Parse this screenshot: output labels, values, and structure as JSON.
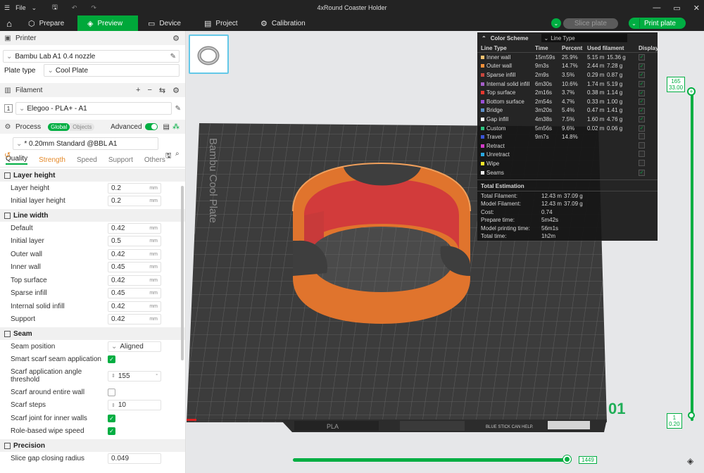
{
  "titlebar": {
    "file_label": "File",
    "title": "4xRound Coaster Holder"
  },
  "nav": {
    "tabs": [
      {
        "label": "Prepare",
        "icon": "cube-icon"
      },
      {
        "label": "Preview",
        "icon": "layers-icon"
      },
      {
        "label": "Device",
        "icon": "monitor-icon"
      },
      {
        "label": "Project",
        "icon": "project-icon"
      },
      {
        "label": "Calibration",
        "icon": "calibration-icon"
      }
    ],
    "slice_label": "Slice plate",
    "print_label": "Print plate",
    "colors": {
      "accent": "#00ae42",
      "bar": "#232323"
    }
  },
  "printer": {
    "section": "Printer",
    "name": "Bambu Lab A1 0.4 nozzle",
    "plate_type_label": "Plate type",
    "plate_type_value": "Cool Plate"
  },
  "filament": {
    "section": "Filament",
    "index": "1",
    "name": "Elegoo - PLA+ - A1"
  },
  "process": {
    "section": "Process",
    "global_label": "Global",
    "objects_label": "Objects",
    "advanced_label": "Advanced",
    "preset": "* 0.20mm Standard @BBL A1",
    "tabs": [
      "Quality",
      "Strength",
      "Speed",
      "Support",
      "Others"
    ]
  },
  "settings": {
    "layer_height": {
      "title": "Layer height",
      "rows": [
        {
          "label": "Layer height",
          "value": "0.2",
          "unit": "mm"
        },
        {
          "label": "Initial layer height",
          "value": "0.2",
          "unit": "mm"
        }
      ]
    },
    "line_width": {
      "title": "Line width",
      "rows": [
        {
          "label": "Default",
          "value": "0.42",
          "unit": "mm"
        },
        {
          "label": "Initial layer",
          "value": "0.5",
          "unit": "mm"
        },
        {
          "label": "Outer wall",
          "value": "0.42",
          "unit": "mm"
        },
        {
          "label": "Inner wall",
          "value": "0.45",
          "unit": "mm"
        },
        {
          "label": "Top surface",
          "value": "0.42",
          "unit": "mm"
        },
        {
          "label": "Sparse infill",
          "value": "0.45",
          "unit": "mm"
        },
        {
          "label": "Internal solid infill",
          "value": "0.42",
          "unit": "mm"
        },
        {
          "label": "Support",
          "value": "0.42",
          "unit": "mm"
        }
      ]
    },
    "seam": {
      "title": "Seam",
      "seam_position_label": "Seam position",
      "seam_position_value": "Aligned",
      "smart_scarf_label": "Smart scarf seam application",
      "angle_label_1": "Scarf application angle",
      "angle_label_2": "threshold",
      "angle_value": "155",
      "angle_unit": "°",
      "around_label": "Scarf around entire wall",
      "steps_label": "Scarf steps",
      "steps_value": "10",
      "inner_label": "Scarf joint for inner walls",
      "role_label": "Role-based wipe speed"
    },
    "precision": {
      "title": "Precision",
      "slice_gap_label": "Slice gap closing radius",
      "slice_gap_value": "0.049"
    }
  },
  "legend": {
    "title": "Color Scheme",
    "scheme": "Line Type",
    "columns": [
      "Line Type",
      "Time",
      "Percent",
      "Used filament",
      "Display"
    ],
    "rows": [
      {
        "name": "Inner wall",
        "color": "#f6c26f",
        "time": "15m59s",
        "percent": "25.9%",
        "len": "5.15 m",
        "weight": "15.36 g",
        "display": true
      },
      {
        "name": "Outer wall",
        "color": "#f7913a",
        "time": "9m3s",
        "percent": "14.7%",
        "len": "2.44 m",
        "weight": "7.28 g",
        "display": true
      },
      {
        "name": "Sparse infill",
        "color": "#c7473d",
        "time": "2m9s",
        "percent": "3.5%",
        "len": "0.29 m",
        "weight": "0.87 g",
        "display": true
      },
      {
        "name": "Internal solid infill",
        "color": "#a55ec8",
        "time": "6m30s",
        "percent": "10.6%",
        "len": "1.74 m",
        "weight": "5.19 g",
        "display": true
      },
      {
        "name": "Top surface",
        "color": "#e8392f",
        "time": "2m16s",
        "percent": "3.7%",
        "len": "0.38 m",
        "weight": "1.14 g",
        "display": true
      },
      {
        "name": "Bottom surface",
        "color": "#9a4fd8",
        "time": "2m54s",
        "percent": "4.7%",
        "len": "0.33 m",
        "weight": "1.00 g",
        "display": true
      },
      {
        "name": "Bridge",
        "color": "#5c8ec9",
        "time": "3m20s",
        "percent": "5.4%",
        "len": "0.47 m",
        "weight": "1.41 g",
        "display": true
      },
      {
        "name": "Gap infill",
        "color": "#ffffff",
        "time": "4m38s",
        "percent": "7.5%",
        "len": "1.60 m",
        "weight": "4.76 g",
        "display": true
      },
      {
        "name": "Custom",
        "color": "#2ec27e",
        "time": "5m56s",
        "percent": "9.6%",
        "len": "0.02 m",
        "weight": "0.06 g",
        "display": true
      },
      {
        "name": "Travel",
        "color": "#3a55d8",
        "time": "9m7s",
        "percent": "14.8%",
        "len": "",
        "weight": "",
        "display": false
      },
      {
        "name": "Retract",
        "color": "#d23ac8",
        "time": "",
        "percent": "",
        "len": "",
        "weight": "",
        "display": false
      },
      {
        "name": "Unretract",
        "color": "#2aa8e0",
        "time": "",
        "percent": "",
        "len": "",
        "weight": "",
        "display": false
      },
      {
        "name": "Wipe",
        "color": "#f5e62a",
        "time": "",
        "percent": "",
        "len": "",
        "weight": "",
        "display": false
      },
      {
        "name": "Seams",
        "color": "#eeeeee",
        "time": "",
        "percent": "",
        "len": "",
        "weight": "",
        "display": true
      }
    ],
    "estimation_title": "Total Estimation",
    "estimation": [
      {
        "k": "Total Filament:",
        "v1": "12.43 m",
        "v2": "37.09 g"
      },
      {
        "k": "Model Filament:",
        "v1": "12.43 m",
        "v2": "37.09 g"
      },
      {
        "k": "Cost:",
        "v1": "0.74",
        "v2": ""
      },
      {
        "k": "Prepare time:",
        "v1": "5m42s",
        "v2": ""
      },
      {
        "k": "Model printing time:",
        "v1": "56m1s",
        "v2": ""
      },
      {
        "k": "Total time:",
        "v1": "1h2m",
        "v2": ""
      }
    ]
  },
  "viewport": {
    "bed_label": "Bambu Cool Plate",
    "plate_number": "01",
    "bed_material": "PLA",
    "bed_warning": "BLUE STICK CAN HELP."
  },
  "sliders": {
    "top_layer": "165",
    "top_height": "33.00",
    "bottom_layer": "1",
    "bottom_height": "0.20",
    "move_value": "1449",
    "top_fraction": 1.0,
    "move_fraction": 0.985
  }
}
